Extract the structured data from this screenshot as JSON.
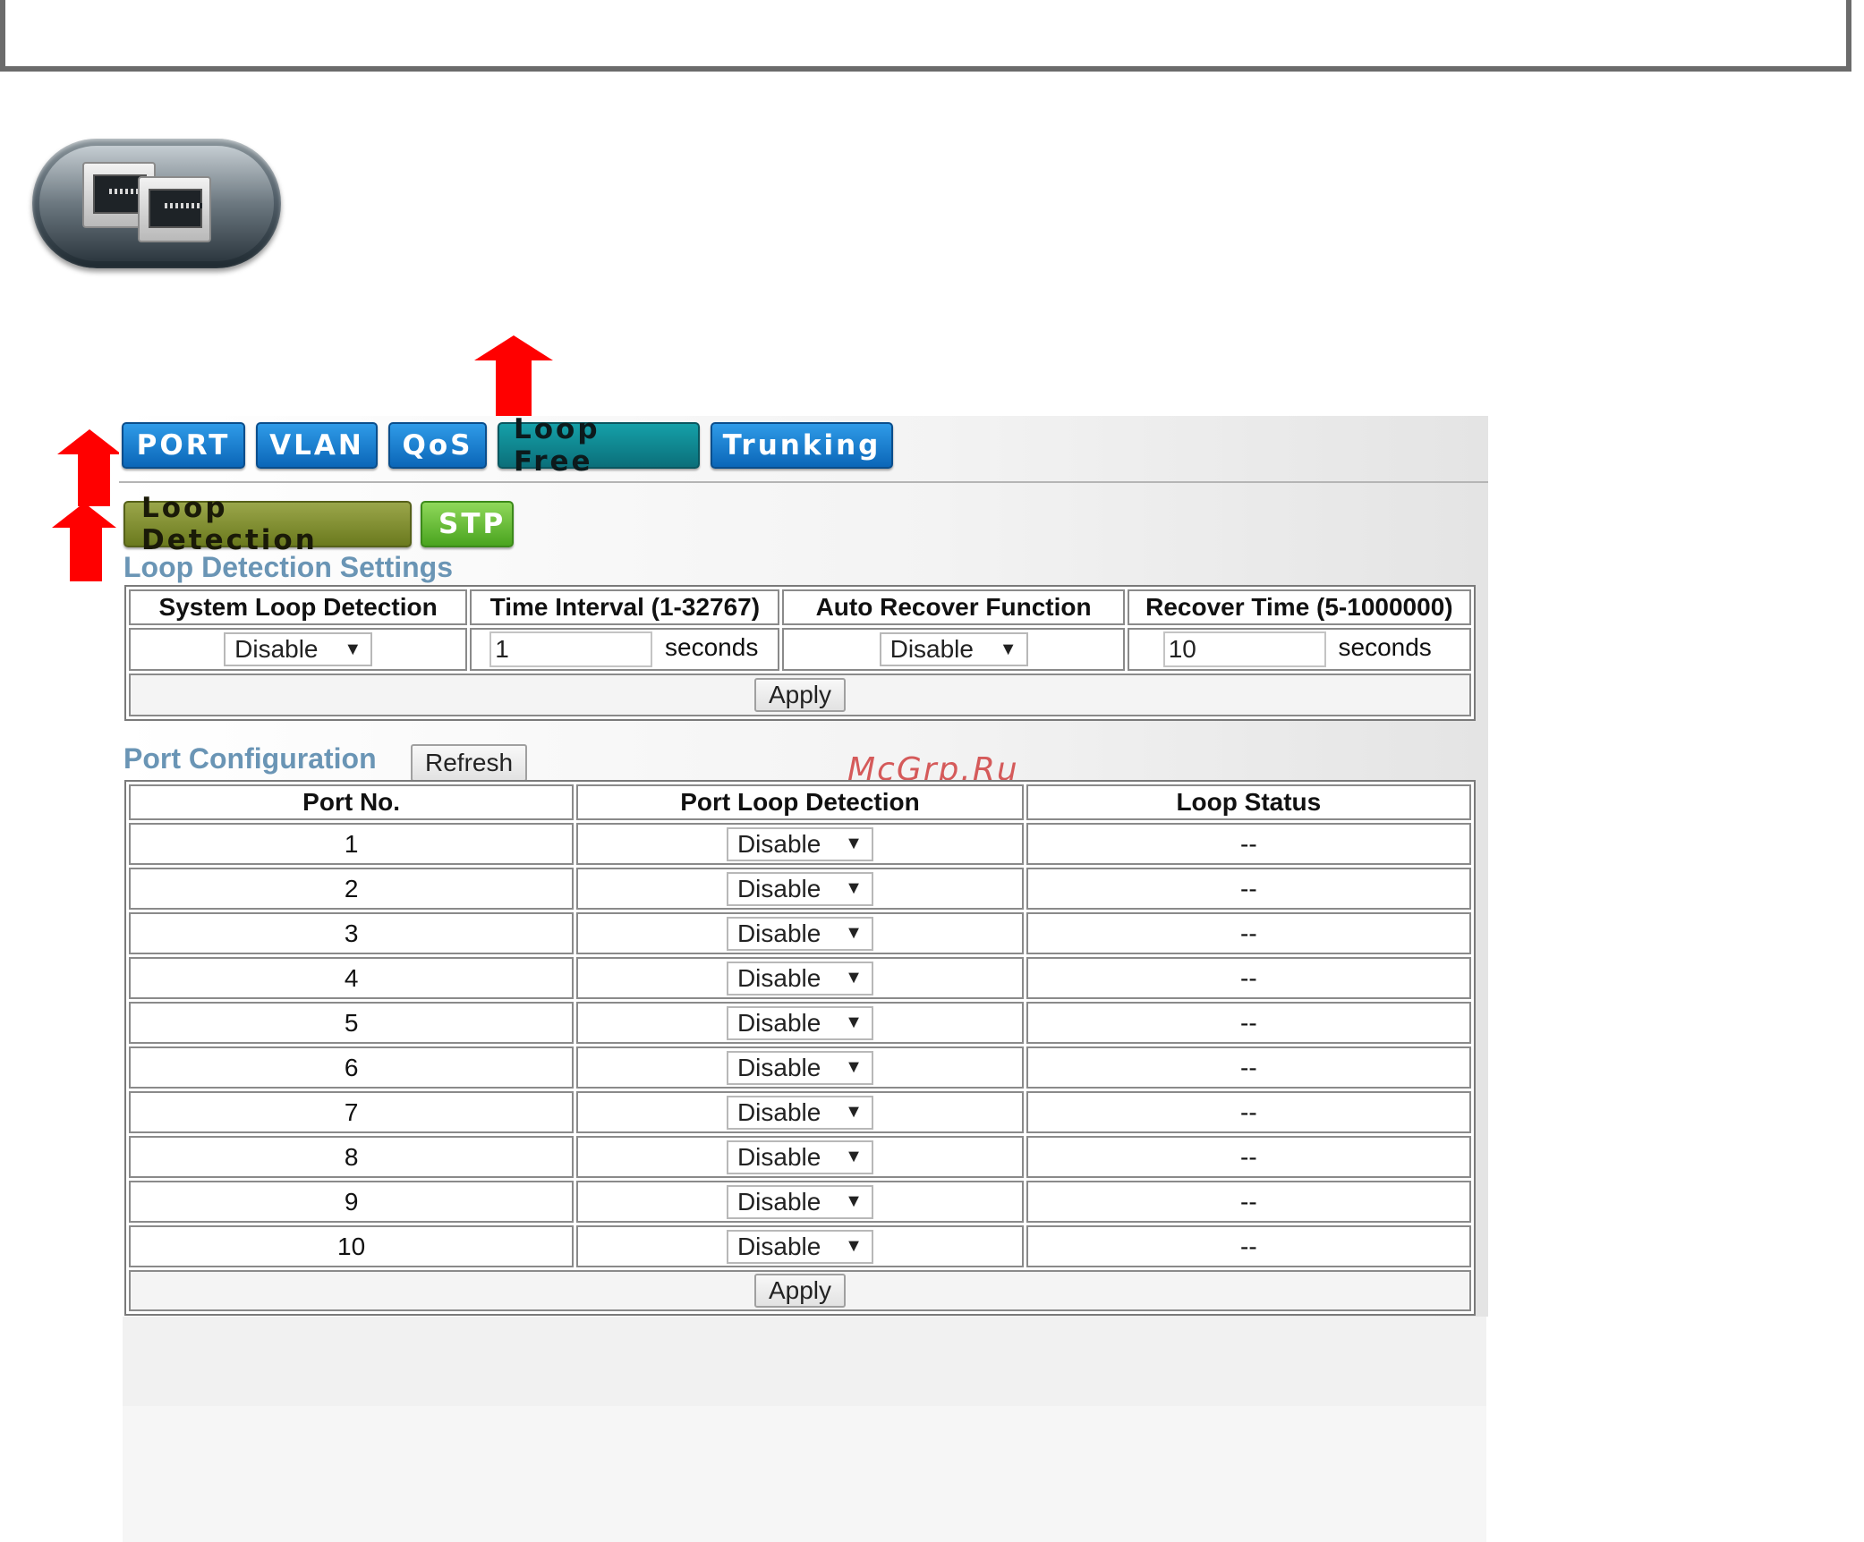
{
  "nav": {
    "tabs": [
      {
        "label": "PORT",
        "active": false
      },
      {
        "label": "VLAN",
        "active": false
      },
      {
        "label": "QoS",
        "active": false
      },
      {
        "label": "Loop Free",
        "active": true
      },
      {
        "label": "Trunking",
        "active": false
      }
    ],
    "subtabs": [
      {
        "label": "Loop Detection",
        "active": true
      },
      {
        "label": "STP",
        "active": false
      }
    ]
  },
  "settings": {
    "title": "Loop Detection Settings",
    "headers": [
      "System Loop Detection",
      "Time Interval (1-32767)",
      "Auto Recover Function",
      "Recover Time (5-1000000)"
    ],
    "system_loop_detection": "Disable",
    "time_interval": "1",
    "time_interval_unit": "seconds",
    "auto_recover": "Disable",
    "recover_time": "10",
    "recover_time_unit": "seconds",
    "apply_label": "Apply"
  },
  "ports": {
    "title": "Port Configuration",
    "refresh_label": "Refresh",
    "headers": [
      "Port No.",
      "Port Loop Detection",
      "Loop Status"
    ],
    "rows": [
      {
        "port": "1",
        "detection": "Disable",
        "status": "--"
      },
      {
        "port": "2",
        "detection": "Disable",
        "status": "--"
      },
      {
        "port": "3",
        "detection": "Disable",
        "status": "--"
      },
      {
        "port": "4",
        "detection": "Disable",
        "status": "--"
      },
      {
        "port": "5",
        "detection": "Disable",
        "status": "--"
      },
      {
        "port": "6",
        "detection": "Disable",
        "status": "--"
      },
      {
        "port": "7",
        "detection": "Disable",
        "status": "--"
      },
      {
        "port": "8",
        "detection": "Disable",
        "status": "--"
      },
      {
        "port": "9",
        "detection": "Disable",
        "status": "--"
      },
      {
        "port": "10",
        "detection": "Disable",
        "status": "--"
      }
    ],
    "apply_label": "Apply"
  },
  "watermark": "McGrp.Ru",
  "icons": {
    "logo": "ethernet-ports-icon",
    "arrows": "red-up-arrow-icon",
    "dropdown": "caret-down-icon"
  },
  "colors": {
    "tab_blue": "#1a7fd2",
    "tab_active": "#0f8a94",
    "subtab_active": "#7f8d2e",
    "subtab_other": "#6cc03a",
    "section_title": "#6a95b5",
    "arrow": "#ff0000"
  }
}
